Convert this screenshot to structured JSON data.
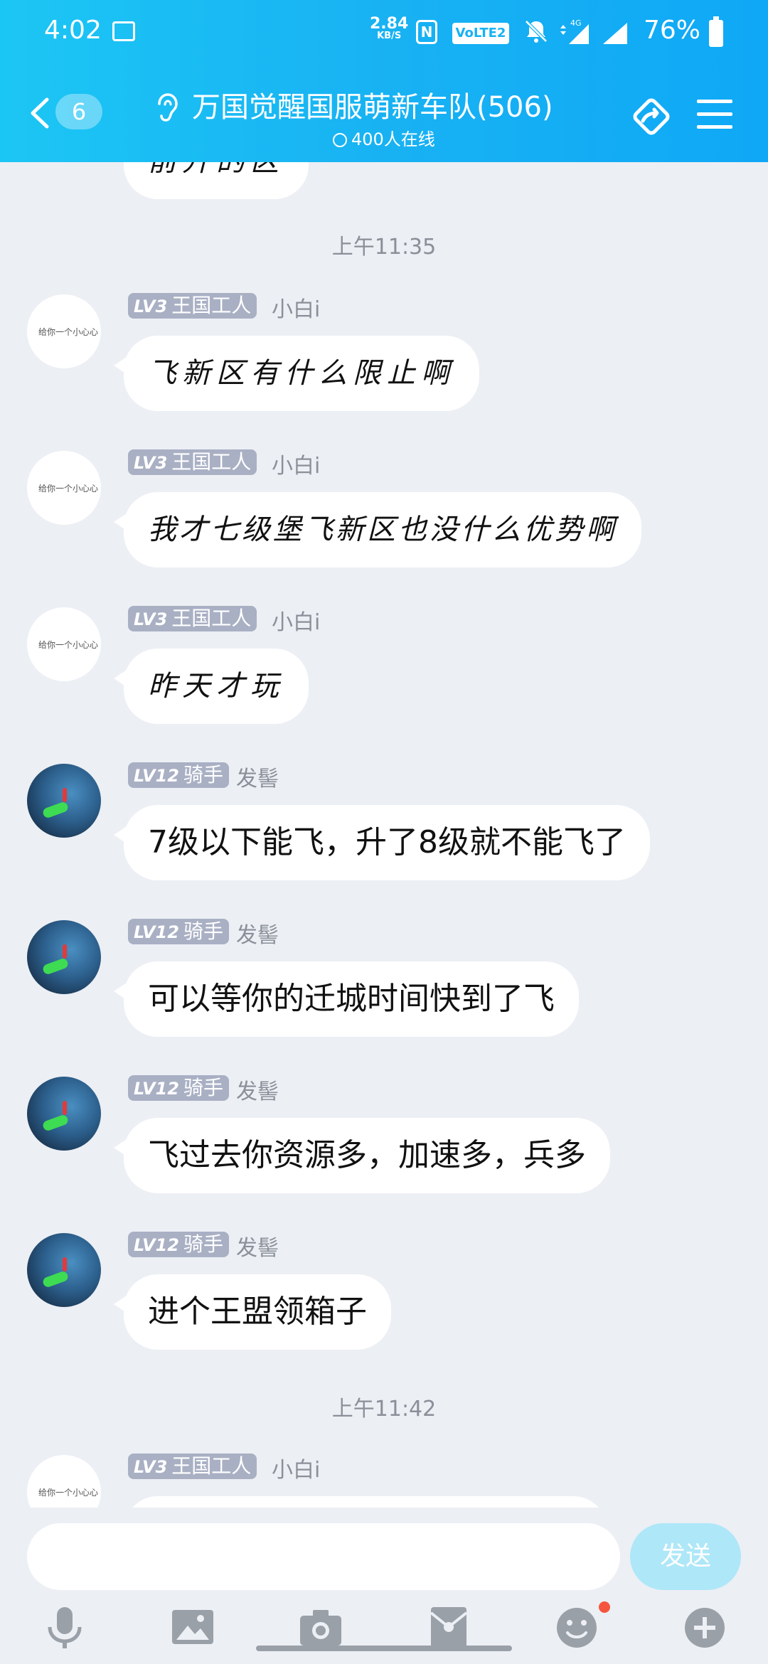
{
  "status_bar": {
    "time": "4:02",
    "speed_value": "2.84",
    "speed_unit": "KB/S",
    "nfc": "N",
    "volte": "VoLTE2",
    "network": "4G",
    "battery": "76%"
  },
  "header": {
    "unread_count": "6",
    "title": "万国觉醒国服萌新车队(506)",
    "online": "400人在线"
  },
  "chat": {
    "partial_top": "前升的区",
    "time1": "上午11:35",
    "time2": "上午11:42",
    "messages": [
      {
        "level": "LV3",
        "title": "王国工人",
        "nick": "小白i",
        "text": "飞新区有什么限止啊"
      },
      {
        "level": "LV3",
        "title": "王国工人",
        "nick": "小白i",
        "text": "我才七级堡飞新区也没什么优势啊"
      },
      {
        "level": "LV3",
        "title": "王国工人",
        "nick": "小白i",
        "text": "昨天才玩"
      },
      {
        "level": "LV12",
        "title": "骑手",
        "nick": "发髻",
        "text": "7级以下能飞，升了8级就不能飞了"
      },
      {
        "level": "LV12",
        "title": "骑手",
        "nick": "发髻",
        "text": "可以等你的迁城时间快到了飞"
      },
      {
        "level": "LV12",
        "title": "骑手",
        "nick": "发髻",
        "text": "飞过去你资源多，加速多，兵多"
      },
      {
        "level": "LV12",
        "title": "骑手",
        "nick": "发髻",
        "text": "进个王盟领箱子"
      },
      {
        "level": "LV3",
        "title": "王国工人",
        "nick": "小白i",
        "text": ""
      }
    ]
  },
  "avatar_caption": "给你一个小心心",
  "input": {
    "placeholder": "",
    "send_label": "发送"
  },
  "colors": {
    "header_start": "#1cc6f4",
    "header_end": "#0fa8f6",
    "chat_bg": "#eceff4",
    "badge": "#a9b0c4",
    "send_button": "#aee7f8",
    "notification_dot": "#f5553e"
  },
  "icons": [
    "image-icon",
    "nfc-icon",
    "bell-off-icon",
    "signal-icon",
    "battery-icon",
    "back-icon",
    "ear-icon",
    "share-icon",
    "menu-icon",
    "microphone-icon",
    "picture-icon",
    "camera-icon",
    "red-packet-icon",
    "emoji-icon",
    "plus-icon"
  ]
}
